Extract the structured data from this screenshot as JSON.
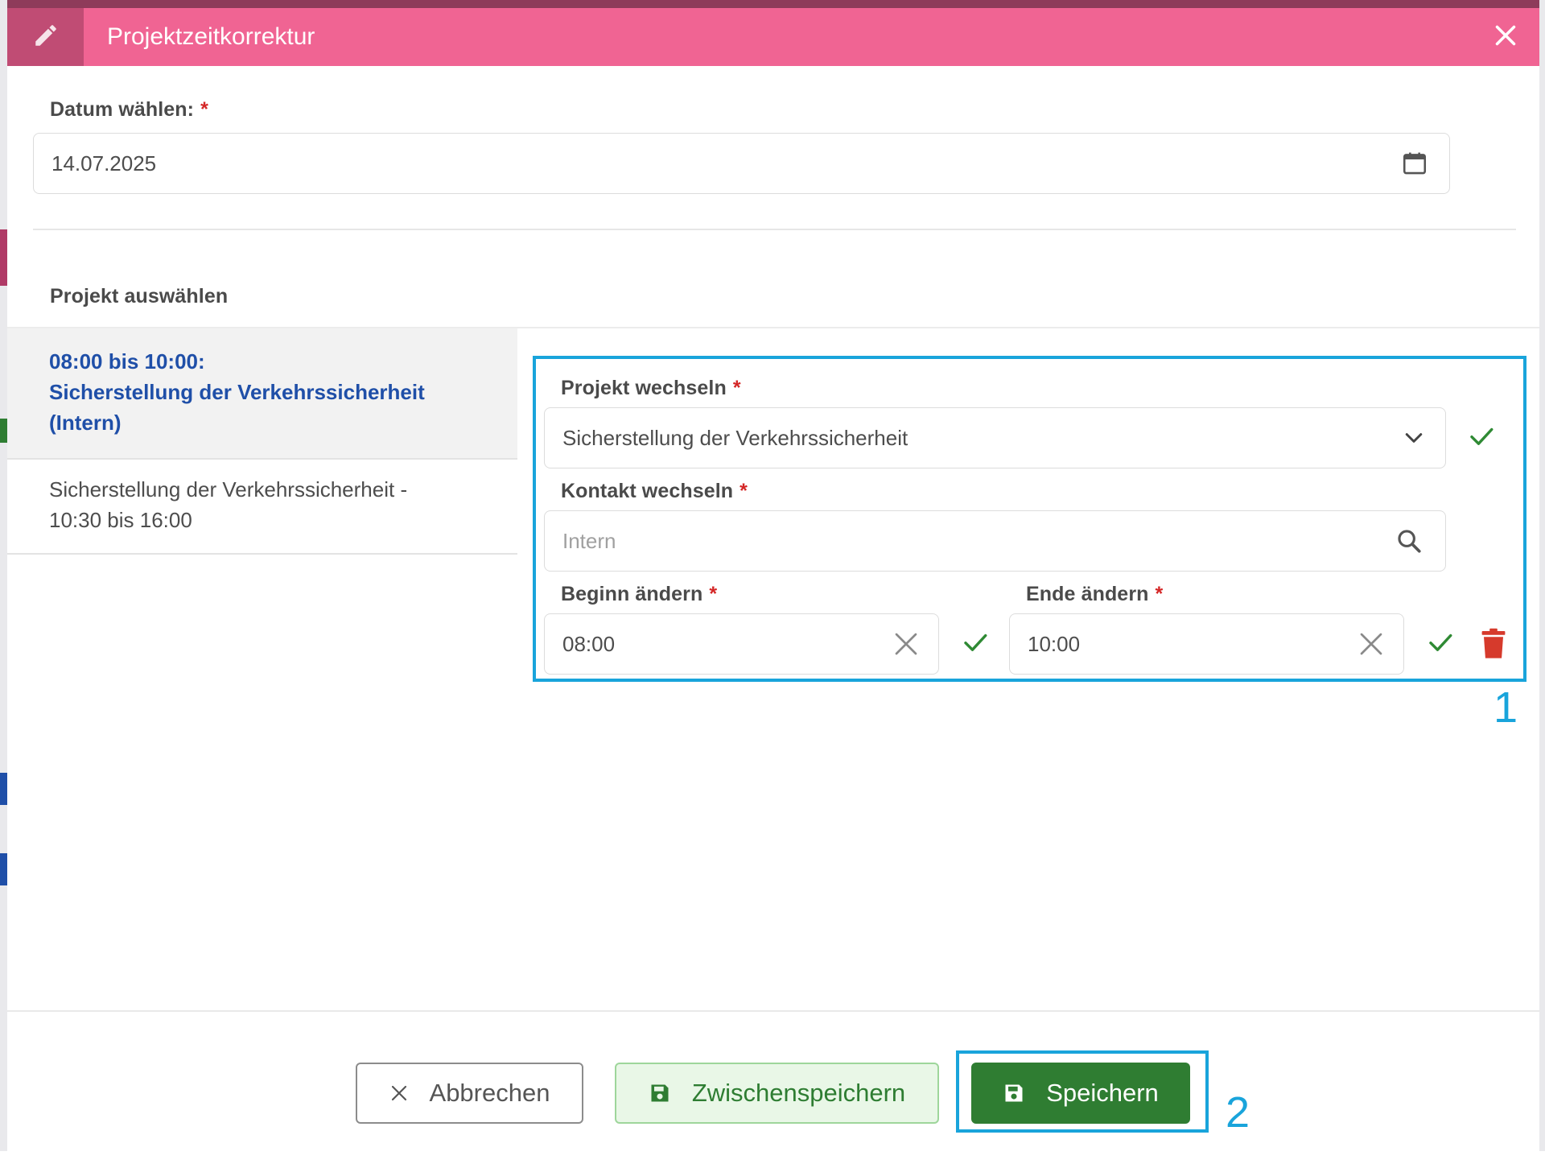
{
  "modal": {
    "title": "Projektzeitkorrektur",
    "header_color": "#f06493"
  },
  "date": {
    "label": "Datum wählen:",
    "required": "*",
    "value": "14.07.2025"
  },
  "project_select": {
    "heading": "Projekt auswählen",
    "items": [
      {
        "line1": "08:00 bis 10:00:",
        "line2": "Sicherstellung der Verkehrssicherheit",
        "line3": "(Intern)",
        "active": true
      },
      {
        "line1": "Sicherstellung der Verkehrssicherheit -",
        "line2": "10:30 bis 16:00",
        "active": false
      }
    ]
  },
  "editor": {
    "project": {
      "label": "Projekt wechseln",
      "required": "*",
      "value": "Sicherstellung der Verkehrssicherheit"
    },
    "contact": {
      "label": "Kontakt wechseln",
      "required": "*",
      "placeholder": "Intern"
    },
    "start": {
      "label": "Beginn ändern",
      "required": "*",
      "value": "08:00"
    },
    "end": {
      "label": "Ende ändern",
      "required": "*",
      "value": "10:00"
    }
  },
  "footer": {
    "cancel_label": "Abbrechen",
    "draft_label": "Zwischenspeichern",
    "save_label": "Speichern"
  },
  "annotations": {
    "callout_1": "1",
    "callout_2": "2",
    "color": "#19a4db"
  },
  "icons": {
    "header": "pencil-icon",
    "close": "close-icon",
    "date": "calendar-icon",
    "project": "chevron-down-icon",
    "contact": "search-icon",
    "clear": "clear-icon",
    "confirm": "check-icon",
    "delete": "trash-icon",
    "save": "floppy-disk-icon"
  },
  "colors": {
    "accent_green": "#2f7d32",
    "active_text": "#1f4fa8",
    "required": "#d42626",
    "delete": "#d63a2c"
  }
}
